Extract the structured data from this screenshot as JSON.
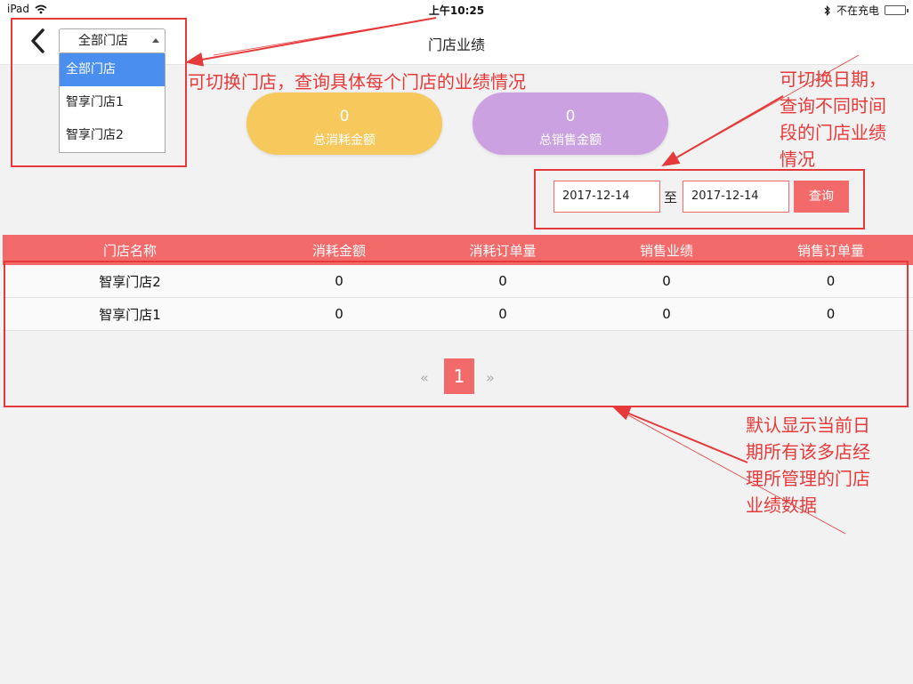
{
  "status_bar": {
    "device": "iPad",
    "time": "上午10:25",
    "battery_text": "不在充电"
  },
  "nav": {
    "title": "门店业绩",
    "store_select": {
      "value": "全部门店",
      "options": [
        "全部门店",
        "智享门店1",
        "智享门店2"
      ]
    }
  },
  "summary": {
    "consume_value": "0",
    "consume_label": "总消耗金额",
    "sales_value": "0",
    "sales_label": "总销售金额"
  },
  "date_filter": {
    "start": "2017-12-14",
    "separator": "至",
    "end": "2017-12-14",
    "query_label": "查询"
  },
  "table": {
    "headers": [
      "门店名称",
      "消耗金额",
      "消耗订单量",
      "销售业绩",
      "销售订单量"
    ],
    "rows": [
      [
        "智享门店2",
        "0",
        "0",
        "0",
        "0"
      ],
      [
        "智享门店1",
        "0",
        "0",
        "0",
        "0"
      ]
    ]
  },
  "pagination": {
    "prev": "«",
    "current": "1",
    "next": "»"
  },
  "annotations": {
    "store_switch": "可切换门店，查询具体每个门店的业绩情况",
    "date_switch": [
      "可切换日期，",
      "查询不同时间",
      "段的门店业绩",
      "情况"
    ],
    "default_data": [
      "默认显示当前日",
      "期所有该多店经",
      "理所管理的门店",
      "业绩数据"
    ]
  },
  "colors": {
    "accent_red": "#f26a6a",
    "pill_yellow": "#f7c95d",
    "pill_purple": "#cba1e2",
    "select_blue": "#4a8ff0",
    "annotation_red": "#e63a3a"
  }
}
